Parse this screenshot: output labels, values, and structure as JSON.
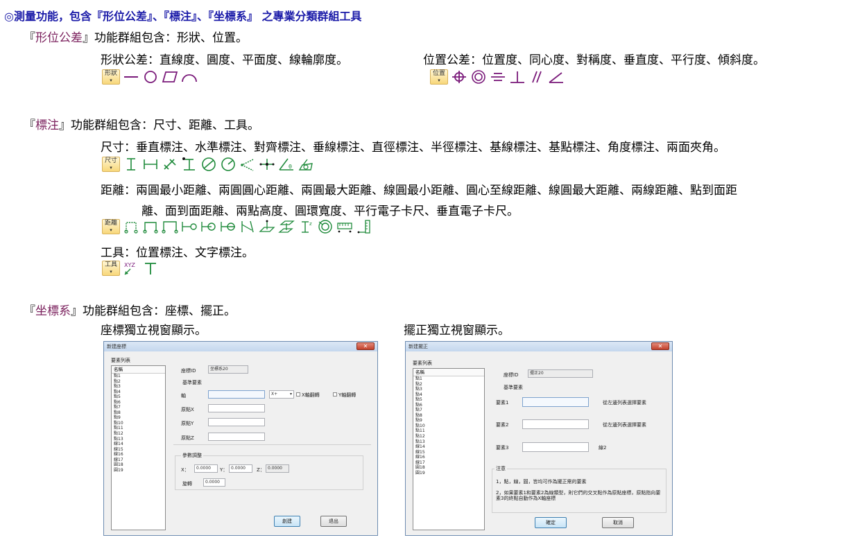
{
  "title": "◎測量功能，包含『形位公差』、『標注』、『坐標系』 之專業分類群組工具",
  "quote_open": "『",
  "quote_close": "』",
  "groups": {
    "form": {
      "name": "形位公差",
      "tail": "功能群組包含：形狀、位置。",
      "shape_line": "形狀公差：直線度、圓度、平面度、線輪廓度。",
      "position_line": "位置公差：位置度、同心度、對稱度、垂直度、平行度、傾斜度。",
      "shape_btn": "形狀",
      "position_btn": "位置"
    },
    "annot": {
      "name": "標注",
      "tail": "功能群組包含：尺寸、距離、工具。",
      "size_line": "尺寸：垂直標注、水準標注、對齊標注、垂線標注、直徑標注、半徑標注、基線標注、基點標注、角度標注、兩面夾角。",
      "dist_line1": "距離：兩圓最小距離、兩圓圓心距離、兩圓最大距離、線圓最小距離、圓心至線距離、線圓最大距離、兩線距離、點到面距",
      "dist_line2": "離、面到面距離、兩點高度、圓環寬度、平行電子卡尺、垂直電子卡尺。",
      "tool_line": "工具：位置標注、文字標注。",
      "size_btn": "尺寸",
      "dist_btn": "距離",
      "tool_btn": "工具"
    },
    "coord": {
      "name": "坐標系",
      "tail": "功能群組包含：座標、擺正。",
      "coord_caption": "座標獨立視窗顯示。",
      "align_caption": "擺正獨立視窗顯示。"
    }
  },
  "dlg_coord": {
    "title": "新建座標",
    "list_title": "要素列表",
    "list_header": "名稱",
    "items": [
      "點1",
      "點2",
      "點3",
      "點4",
      "點5",
      "點6",
      "點7",
      "點8",
      "點9",
      "點10",
      "點11",
      "點12",
      "點13",
      "線14",
      "線15",
      "線16",
      "線17",
      "圓18",
      "圓19"
    ],
    "id_label": "座標ID",
    "id_value": "坐標系20",
    "ref_label": "基準要素",
    "axis_label": "軸",
    "axis_select": "X+",
    "x_reverse": "X軸翻轉",
    "y_reverse": "Y軸翻轉",
    "origin_x": "原點X",
    "origin_y": "原點Y",
    "origin_z": "原點Z",
    "param_label": "參數調整",
    "x_label": "X：",
    "y_label": "Y：",
    "z_label": "Z：",
    "x_val": "0.0000",
    "y_val": "0.0000",
    "z_val": "0.0000",
    "rot_label": "旋轉",
    "rot_val": "0.0000",
    "ok": "創建",
    "cancel": "退出"
  },
  "dlg_align": {
    "title": "新建擺正",
    "list_title": "要素列表",
    "list_header": "名稱",
    "items": [
      "點1",
      "點2",
      "點3",
      "點4",
      "點5",
      "點6",
      "點7",
      "點8",
      "點9",
      "點10",
      "點11",
      "點12",
      "點13",
      "線14",
      "線15",
      "線16",
      "線17",
      "圓18",
      "圓19"
    ],
    "id_label": "座標ID",
    "id_value": "擺正20",
    "ref_label": "基準要素",
    "el1": "要素1",
    "el2": "要素2",
    "el3": "要素3",
    "hint1": "從左邊列表選擇要素",
    "hint2": "從左邊列表選擇要素",
    "el3_val": "線2",
    "note_label": "注意",
    "note1": "1，點，線，圓，皆均可作為擺正需的要素",
    "note2": "2，如果要素1和要素2為線類型，則它們的交叉點作為原點座標，原點指向要素3的終點自動作為X軸座標",
    "ok": "確定",
    "cancel": "取消"
  },
  "colors": {
    "title": "#1a1aa8",
    "group_name": "#7a1f5c",
    "tol_icon": "#7a1a7a",
    "dim_icon": "#1e8a3a"
  }
}
